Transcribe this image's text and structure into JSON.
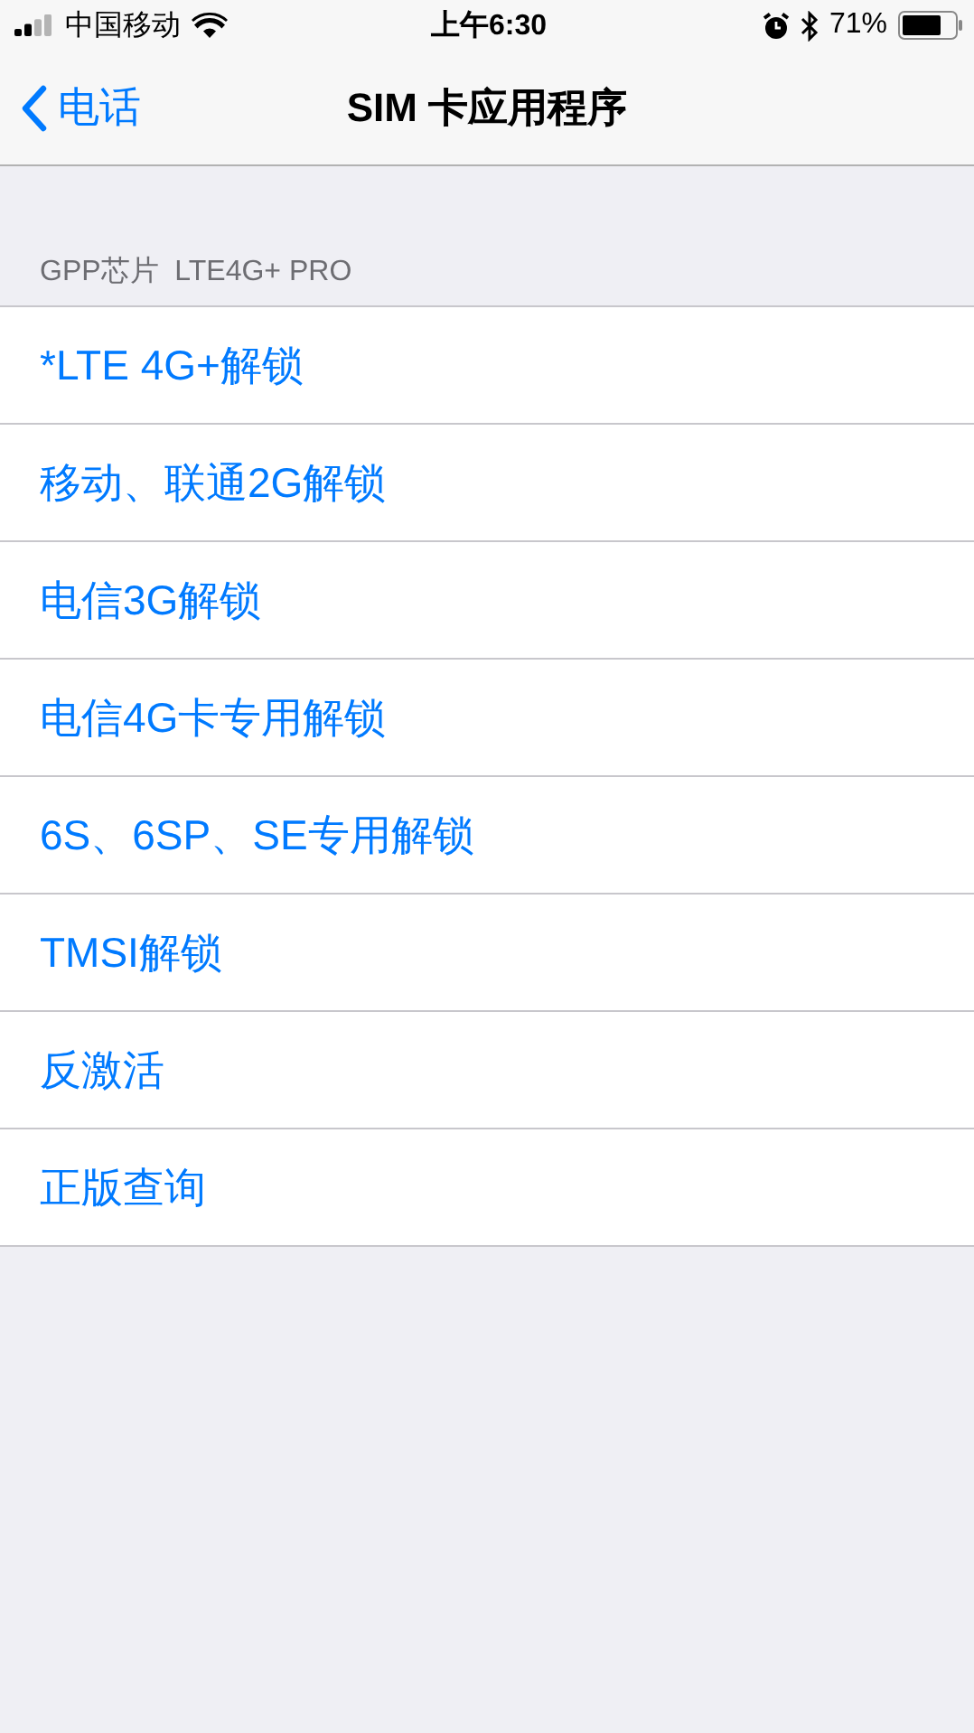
{
  "status_bar": {
    "carrier": "中国移动",
    "time": "上午6:30",
    "battery": "71%"
  },
  "nav_bar": {
    "back": "电话",
    "title": "SIM 卡应用程序"
  },
  "section": {
    "header": "GPP芯片  LTE4G+ PRO",
    "items": [
      {
        "label": "*LTE 4G+解锁"
      },
      {
        "label": "移动、联通2G解锁"
      },
      {
        "label": "电信3G解锁"
      },
      {
        "label": "电信4G卡专用解锁"
      },
      {
        "label": "6S、6SP、SE专用解锁"
      },
      {
        "label": "TMSI解锁"
      },
      {
        "label": "反激活"
      },
      {
        "label": "正版查询"
      }
    ]
  }
}
